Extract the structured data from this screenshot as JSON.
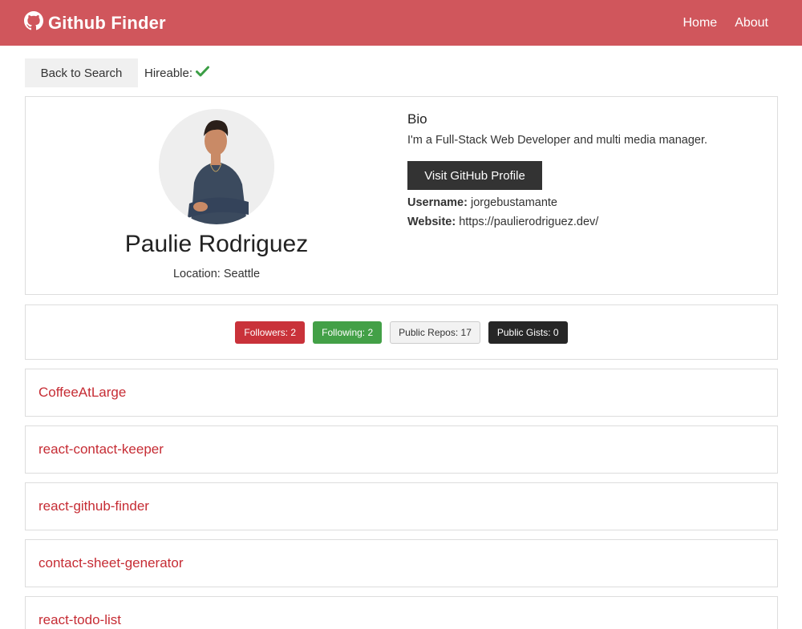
{
  "nav": {
    "brand": "Github Finder",
    "brand_icon": "github-icon",
    "links": [
      "Home",
      "About"
    ],
    "color": "#d0565c"
  },
  "actions": {
    "back_label": "Back to Search",
    "hireable_label": "Hireable:",
    "hireable_icon": "check-icon",
    "hireable_color": "#3b9e45"
  },
  "profile": {
    "name": "Paulie Rodriguez",
    "location": "Location: Seattle",
    "bio_title": "Bio",
    "bio": "I'm a Full-Stack Web Developer and multi media manager.",
    "visit_label": "Visit GitHub Profile",
    "username_key": "Username:",
    "username": "jorgebustamante",
    "website_key": "Website:",
    "website": "https://paulierodriguez.dev/"
  },
  "stats": {
    "followers": "Followers: 2",
    "following": "Following: 2",
    "repos": "Public Repos: 17",
    "gists": "Public Gists: 0"
  },
  "repos": [
    "CoffeeAtLarge",
    "react-contact-keeper",
    "react-github-finder",
    "contact-sheet-generator",
    "react-todo-list"
  ]
}
